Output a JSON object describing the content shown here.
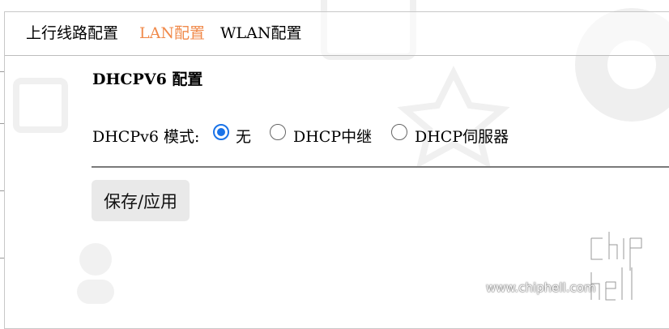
{
  "tabs": [
    {
      "label": "上行线路配置",
      "active": false
    },
    {
      "label": "LAN配置",
      "active": true
    },
    {
      "label": "WLAN配置",
      "active": false
    }
  ],
  "section": {
    "title": "DHCPV6 配置"
  },
  "dhcpv6_mode": {
    "label": "DHCPv6 模式:",
    "options": [
      {
        "label": "无",
        "checked": true
      },
      {
        "label": "DHCP中继",
        "checked": false
      },
      {
        "label": "DHCP伺服器",
        "checked": false
      }
    ]
  },
  "save_button": {
    "label": "保存/应用"
  },
  "watermark": {
    "site": "www.chiphell.com",
    "logo_text": "chiphell"
  },
  "colors": {
    "active_tab": "#f08a4b",
    "radio_accent": "#1a73e8",
    "button_bg": "#e9e9e9"
  }
}
